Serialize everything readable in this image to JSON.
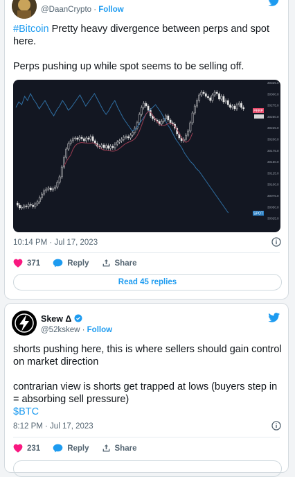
{
  "tweet1": {
    "handle": "@DaanCrypto",
    "follow_label": "Follow",
    "hashtag": "#Bitcoin",
    "text_line1_rest": " Pretty heavy divergence between perps and spot here.",
    "text_line2": "Perps pushing up while spot seems to be selling off.",
    "timestamp": "10:14 PM · Jul 17, 2023",
    "likes": "371",
    "reply_label": "Reply",
    "share_label": "Share",
    "read_replies": "Read 45 replies",
    "chart": {
      "y_ticks": [
        "30325.0",
        "30300.0",
        "30275.0",
        "30250.0",
        "30225.0",
        "30200.0",
        "30175.0",
        "30150.0",
        "30125.0",
        "30100.0",
        "30075.0",
        "30050.0",
        "30025.0"
      ],
      "badges": [
        "PERP",
        "SPOT"
      ]
    }
  },
  "tweet2": {
    "name": "Skew Δ",
    "handle": "@52kskew",
    "follow_label": "Follow",
    "text_line1": "shorts pushing here, this is where sellers should gain control on market direction",
    "text_line2": "contrarian view is shorts get trapped at lows (buyers step in = absorbing sell pressure)",
    "cashtag": "$BTC",
    "timestamp": "8:12 PM · Jul 17, 2023",
    "likes": "231",
    "reply_label": "Reply",
    "share_label": "Share"
  },
  "colors": {
    "accent": "#1d9bf0",
    "like": "#f91880",
    "chart_bg": "#131722",
    "spot_line": "#2f6fa3",
    "perp_line": "#9b3d52"
  }
}
